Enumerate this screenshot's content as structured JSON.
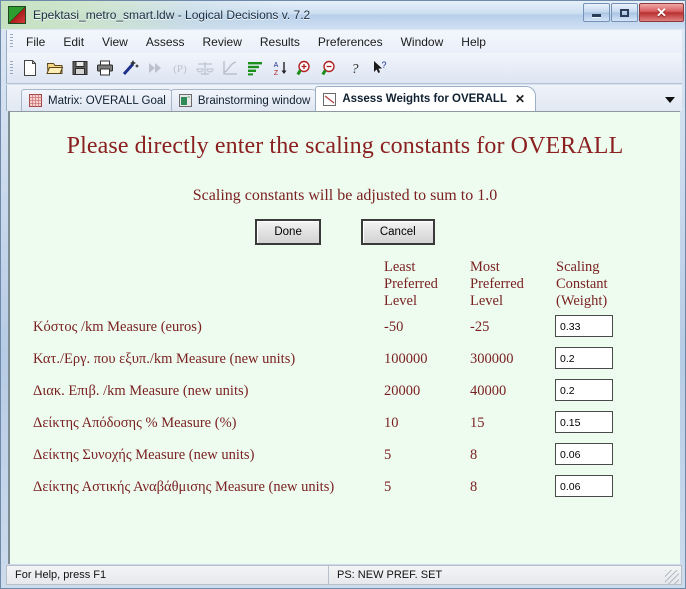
{
  "window": {
    "title": "Epektasi_metro_smart.ldw - Logical Decisions v. 7.2",
    "icon": "app-logo-icon",
    "minimize_label": "–",
    "maximize_label": "□",
    "close_label": "✕"
  },
  "menu": {
    "items": [
      {
        "label": "File"
      },
      {
        "label": "Edit"
      },
      {
        "label": "View"
      },
      {
        "label": "Assess"
      },
      {
        "label": "Review"
      },
      {
        "label": "Results"
      },
      {
        "label": "Preferences"
      },
      {
        "label": "Window"
      },
      {
        "label": "Help"
      }
    ]
  },
  "toolbar": {
    "buttons": [
      {
        "icon": "new-document-icon",
        "enabled": true
      },
      {
        "icon": "open-folder-icon",
        "enabled": true
      },
      {
        "icon": "save-disk-icon",
        "enabled": true
      },
      {
        "icon": "print-icon",
        "enabled": true
      },
      {
        "icon": "magic-wand-icon",
        "enabled": true
      },
      {
        "icon": "fast-forward-icon",
        "enabled": false
      },
      {
        "icon": "probability-p-icon",
        "enabled": false
      },
      {
        "icon": "balance-scales-icon",
        "enabled": false
      },
      {
        "icon": "line-chart-icon",
        "enabled": false
      },
      {
        "icon": "bar-chart-icon",
        "enabled": true
      },
      {
        "icon": "sort-az-icon",
        "enabled": true
      },
      {
        "icon": "zoom-in-icon",
        "enabled": true
      },
      {
        "icon": "zoom-out-icon",
        "enabled": true
      },
      {
        "icon": "help-question-icon",
        "enabled": true
      },
      {
        "icon": "help-pointer-icon",
        "enabled": true
      }
    ]
  },
  "tabs": {
    "items": [
      {
        "label": "Matrix: OVERALL Goal",
        "icon": "red-grid-icon",
        "active": false,
        "closable": false
      },
      {
        "label": "Brainstorming window",
        "icon": "green-window-icon",
        "active": false,
        "closable": false
      },
      {
        "label": "Assess Weights for OVERALL",
        "icon": "red-line-chart-icon",
        "active": true,
        "closable": true,
        "close_label": "✕"
      }
    ],
    "overflow_icon": "chevron-down-icon"
  },
  "main": {
    "title": "Please directly enter the scaling constants for OVERALL",
    "subtitle": "Scaling constants will be adjusted to sum to 1.0",
    "done_label": "Done",
    "cancel_label": "Cancel",
    "columns": {
      "measure": "",
      "least": "Least\nPreferred\nLevel",
      "most": "Most\nPreferred\nLevel",
      "scaling": "Scaling\nConstant\n(Weight)"
    },
    "rows": [
      {
        "label": "Κόστος /km Measure (euros)",
        "least": "-50",
        "most": "-25",
        "weight": "0.33"
      },
      {
        "label": "Κατ./Εργ. που εξυπ./km Measure (new units)",
        "least": "100000",
        "most": "300000",
        "weight": "0.2"
      },
      {
        "label": "Διακ. Επιβ. /km Measure (new units)",
        "least": "20000",
        "most": "40000",
        "weight": "0.2"
      },
      {
        "label": "Δείκτης Απόδοσης % Measure (%)",
        "least": "10",
        "most": "15",
        "weight": "0.15"
      },
      {
        "label": "Δείκτης Συνοχής Measure (new units)",
        "least": "5",
        "most": "8",
        "weight": "0.06"
      },
      {
        "label": "Δείκτης Αστικής Αναβάθμισης Measure (new units)",
        "least": "5",
        "most": "8",
        "weight": "0.06"
      }
    ]
  },
  "statusbar": {
    "help_text": "For Help, press F1",
    "pref_set": "PS: NEW PREF. SET"
  },
  "colors": {
    "content_bg": "#eefcf0",
    "text_maroon": "#7a2222",
    "title_maroon": "#8b2020",
    "accent_green": "#2f9c30",
    "accent_red": "#a81d1d"
  }
}
